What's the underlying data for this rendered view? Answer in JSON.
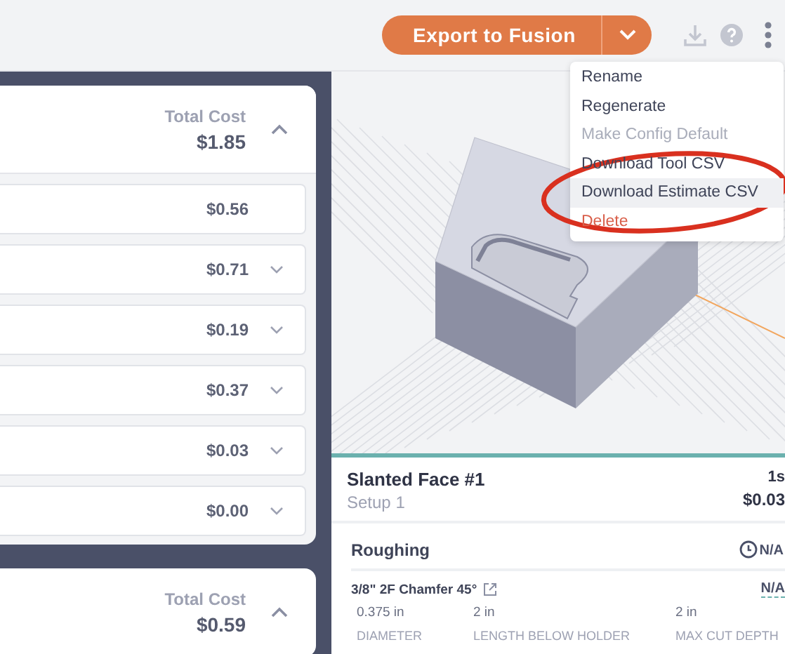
{
  "toolbar": {
    "export_label": "Export to Fusion"
  },
  "menu": {
    "items": [
      {
        "label": "Rename",
        "kind": "normal",
        "disabled": false,
        "highlighted": false
      },
      {
        "label": "Regenerate",
        "kind": "normal",
        "disabled": false,
        "highlighted": false
      },
      {
        "label": "Make Config Default",
        "kind": "normal",
        "disabled": true,
        "highlighted": false
      },
      {
        "label": "Download Tool CSV",
        "kind": "normal",
        "disabled": false,
        "highlighted": false
      },
      {
        "label": "Download Estimate CSV",
        "kind": "normal",
        "disabled": false,
        "highlighted": true
      },
      {
        "label": "Delete",
        "kind": "danger",
        "disabled": false,
        "highlighted": false
      }
    ]
  },
  "cost_cards": [
    {
      "total_label": "Total Cost",
      "total": "$1.85",
      "expanded": true,
      "rows": [
        {
          "cost": "$0.56",
          "expandable": false
        },
        {
          "cost": "$0.71",
          "expandable": true
        },
        {
          "cost": "$0.19",
          "expandable": true
        },
        {
          "cost": "$0.37",
          "expandable": true
        },
        {
          "cost": "$0.03",
          "expandable": true
        },
        {
          "cost": "$0.00",
          "expandable": true
        }
      ]
    },
    {
      "total_label": "Total Cost",
      "total": "$0.59",
      "expanded": true
    }
  ],
  "details": {
    "title": "Slanted Face #1",
    "subtitle": "Setup 1",
    "time": "1s",
    "cost": "$0.03",
    "operation": {
      "name": "Roughing",
      "status": "N/A"
    },
    "tool": {
      "name": "3/8\" 2F Chamfer 45°",
      "value": "N/A",
      "specs": [
        {
          "value": "0.375 in",
          "label": "DIAMETER"
        },
        {
          "value": "2 in",
          "label": "LENGTH BELOW HOLDER"
        },
        {
          "value": "2 in",
          "label": "MAX CUT DEPTH"
        }
      ]
    }
  }
}
